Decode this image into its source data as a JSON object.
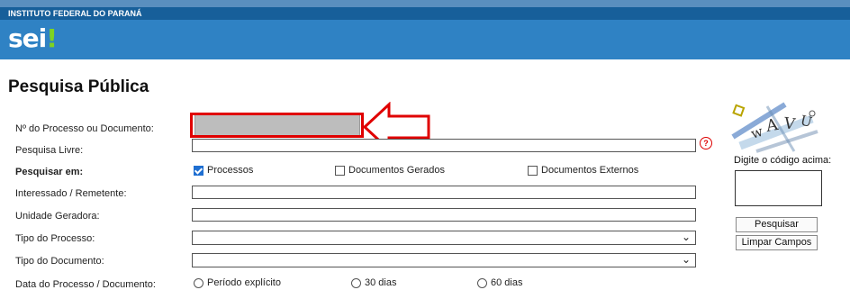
{
  "header": {
    "institution": "INSTITUTO FEDERAL DO PARANÁ",
    "logo_text": "sei",
    "logo_mark": "!"
  },
  "page_title": "Pesquisa Pública",
  "form": {
    "process_number_label": "Nº do Processo ou Documento:",
    "free_search_label": "Pesquisa Livre:",
    "search_in_label": "Pesquisar em:",
    "interested_label": "Interessado / Remetente:",
    "unit_label": "Unidade Geradora:",
    "process_type_label": "Tipo do Processo:",
    "document_type_label": "Tipo do Documento:",
    "date_label": "Data do Processo / Documento:",
    "help_icon": "?",
    "checkboxes": [
      {
        "label": "Processos",
        "checked": true
      },
      {
        "label": "Documentos Gerados",
        "checked": false
      },
      {
        "label": "Documentos Externos",
        "checked": false
      }
    ],
    "radios": [
      {
        "label": "Período explícito"
      },
      {
        "label": "30 dias"
      },
      {
        "label": "60 dias"
      }
    ]
  },
  "captcha": {
    "prompt": "Digite o código acima:"
  },
  "buttons": {
    "search": "Pesquisar",
    "clear": "Limpar Campos"
  },
  "colors": {
    "banner": "#2f82c4",
    "institution_bar": "#175f9a",
    "highlight": "#e00000",
    "checkbox_checked": "#1f6fd1"
  }
}
